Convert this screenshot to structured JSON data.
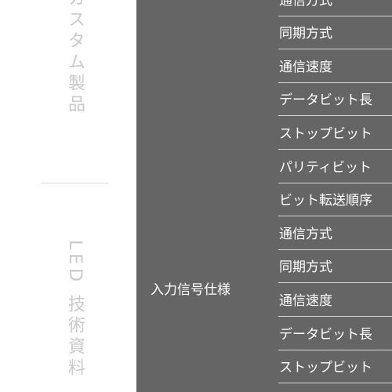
{
  "sidebar": {
    "top_text": "カスタム製品",
    "bottom_text": "LED 技術資料"
  },
  "spec_table": {
    "group_label": "入力信号仕様",
    "rows": [
      "通信方式",
      "同期方式",
      "通信速度",
      "データビット長",
      "ストップビット",
      "パリティビット",
      "ビット転送順序",
      "通信方式",
      "同期方式",
      "通信速度",
      "データビット長",
      "ストップビット"
    ]
  }
}
